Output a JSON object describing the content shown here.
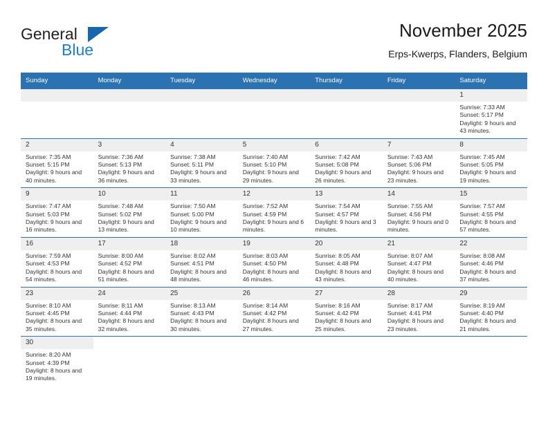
{
  "brand": {
    "line1": "General",
    "line2": "Blue",
    "accent_color": "#1b7fd4",
    "triangle_color": "#1568b0",
    "icon": "general-blue-logo"
  },
  "header": {
    "title": "November 2025",
    "subtitle": "Erps-Kwerps, Flanders, Belgium"
  },
  "calendar": {
    "header_color": "#2b72b3",
    "weekday_headers": [
      "Sunday",
      "Monday",
      "Tuesday",
      "Wednesday",
      "Thursday",
      "Friday",
      "Saturday"
    ],
    "weeks": [
      [
        {
          "day": "",
          "blank": true
        },
        {
          "day": "",
          "blank": true
        },
        {
          "day": "",
          "blank": true
        },
        {
          "day": "",
          "blank": true
        },
        {
          "day": "",
          "blank": true
        },
        {
          "day": "",
          "blank": true
        },
        {
          "day": "1",
          "sunrise": "Sunrise: 7:33 AM",
          "sunset": "Sunset: 5:17 PM",
          "daylight": "Daylight: 9 hours and 43 minutes."
        }
      ],
      [
        {
          "day": "2",
          "sunrise": "Sunrise: 7:35 AM",
          "sunset": "Sunset: 5:15 PM",
          "daylight": "Daylight: 9 hours and 40 minutes."
        },
        {
          "day": "3",
          "sunrise": "Sunrise: 7:36 AM",
          "sunset": "Sunset: 5:13 PM",
          "daylight": "Daylight: 9 hours and 36 minutes."
        },
        {
          "day": "4",
          "sunrise": "Sunrise: 7:38 AM",
          "sunset": "Sunset: 5:11 PM",
          "daylight": "Daylight: 9 hours and 33 minutes."
        },
        {
          "day": "5",
          "sunrise": "Sunrise: 7:40 AM",
          "sunset": "Sunset: 5:10 PM",
          "daylight": "Daylight: 9 hours and 29 minutes."
        },
        {
          "day": "6",
          "sunrise": "Sunrise: 7:42 AM",
          "sunset": "Sunset: 5:08 PM",
          "daylight": "Daylight: 9 hours and 26 minutes."
        },
        {
          "day": "7",
          "sunrise": "Sunrise: 7:43 AM",
          "sunset": "Sunset: 5:06 PM",
          "daylight": "Daylight: 9 hours and 23 minutes."
        },
        {
          "day": "8",
          "sunrise": "Sunrise: 7:45 AM",
          "sunset": "Sunset: 5:05 PM",
          "daylight": "Daylight: 9 hours and 19 minutes."
        }
      ],
      [
        {
          "day": "9",
          "sunrise": "Sunrise: 7:47 AM",
          "sunset": "Sunset: 5:03 PM",
          "daylight": "Daylight: 9 hours and 16 minutes."
        },
        {
          "day": "10",
          "sunrise": "Sunrise: 7:48 AM",
          "sunset": "Sunset: 5:02 PM",
          "daylight": "Daylight: 9 hours and 13 minutes."
        },
        {
          "day": "11",
          "sunrise": "Sunrise: 7:50 AM",
          "sunset": "Sunset: 5:00 PM",
          "daylight": "Daylight: 9 hours and 10 minutes."
        },
        {
          "day": "12",
          "sunrise": "Sunrise: 7:52 AM",
          "sunset": "Sunset: 4:59 PM",
          "daylight": "Daylight: 9 hours and 6 minutes."
        },
        {
          "day": "13",
          "sunrise": "Sunrise: 7:54 AM",
          "sunset": "Sunset: 4:57 PM",
          "daylight": "Daylight: 9 hours and 3 minutes."
        },
        {
          "day": "14",
          "sunrise": "Sunrise: 7:55 AM",
          "sunset": "Sunset: 4:56 PM",
          "daylight": "Daylight: 9 hours and 0 minutes."
        },
        {
          "day": "15",
          "sunrise": "Sunrise: 7:57 AM",
          "sunset": "Sunset: 4:55 PM",
          "daylight": "Daylight: 8 hours and 57 minutes."
        }
      ],
      [
        {
          "day": "16",
          "sunrise": "Sunrise: 7:59 AM",
          "sunset": "Sunset: 4:53 PM",
          "daylight": "Daylight: 8 hours and 54 minutes."
        },
        {
          "day": "17",
          "sunrise": "Sunrise: 8:00 AM",
          "sunset": "Sunset: 4:52 PM",
          "daylight": "Daylight: 8 hours and 51 minutes."
        },
        {
          "day": "18",
          "sunrise": "Sunrise: 8:02 AM",
          "sunset": "Sunset: 4:51 PM",
          "daylight": "Daylight: 8 hours and 48 minutes."
        },
        {
          "day": "19",
          "sunrise": "Sunrise: 8:03 AM",
          "sunset": "Sunset: 4:50 PM",
          "daylight": "Daylight: 8 hours and 46 minutes."
        },
        {
          "day": "20",
          "sunrise": "Sunrise: 8:05 AM",
          "sunset": "Sunset: 4:48 PM",
          "daylight": "Daylight: 8 hours and 43 minutes."
        },
        {
          "day": "21",
          "sunrise": "Sunrise: 8:07 AM",
          "sunset": "Sunset: 4:47 PM",
          "daylight": "Daylight: 8 hours and 40 minutes."
        },
        {
          "day": "22",
          "sunrise": "Sunrise: 8:08 AM",
          "sunset": "Sunset: 4:46 PM",
          "daylight": "Daylight: 8 hours and 37 minutes."
        }
      ],
      [
        {
          "day": "23",
          "sunrise": "Sunrise: 8:10 AM",
          "sunset": "Sunset: 4:45 PM",
          "daylight": "Daylight: 8 hours and 35 minutes."
        },
        {
          "day": "24",
          "sunrise": "Sunrise: 8:11 AM",
          "sunset": "Sunset: 4:44 PM",
          "daylight": "Daylight: 8 hours and 32 minutes."
        },
        {
          "day": "25",
          "sunrise": "Sunrise: 8:13 AM",
          "sunset": "Sunset: 4:43 PM",
          "daylight": "Daylight: 8 hours and 30 minutes."
        },
        {
          "day": "26",
          "sunrise": "Sunrise: 8:14 AM",
          "sunset": "Sunset: 4:42 PM",
          "daylight": "Daylight: 8 hours and 27 minutes."
        },
        {
          "day": "27",
          "sunrise": "Sunrise: 8:16 AM",
          "sunset": "Sunset: 4:42 PM",
          "daylight": "Daylight: 8 hours and 25 minutes."
        },
        {
          "day": "28",
          "sunrise": "Sunrise: 8:17 AM",
          "sunset": "Sunset: 4:41 PM",
          "daylight": "Daylight: 8 hours and 23 minutes."
        },
        {
          "day": "29",
          "sunrise": "Sunrise: 8:19 AM",
          "sunset": "Sunset: 4:40 PM",
          "daylight": "Daylight: 8 hours and 21 minutes."
        }
      ],
      [
        {
          "day": "30",
          "sunrise": "Sunrise: 8:20 AM",
          "sunset": "Sunset: 4:39 PM",
          "daylight": "Daylight: 8 hours and 19 minutes."
        },
        {
          "day": "",
          "nocell": true
        },
        {
          "day": "",
          "nocell": true
        },
        {
          "day": "",
          "nocell": true
        },
        {
          "day": "",
          "nocell": true
        },
        {
          "day": "",
          "nocell": true
        },
        {
          "day": "",
          "nocell": true
        }
      ]
    ]
  }
}
